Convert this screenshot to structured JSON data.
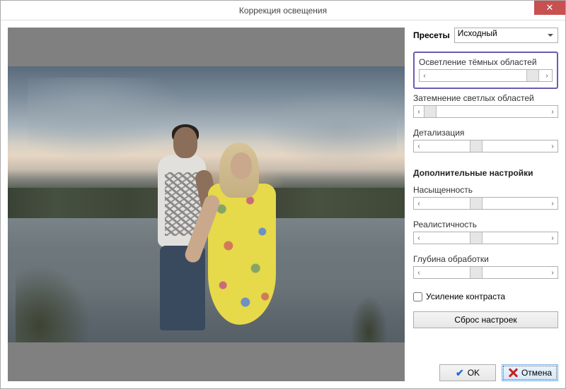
{
  "window": {
    "title": "Коррекция освещения"
  },
  "presets": {
    "label": "Пресеты",
    "selected": "Исходный"
  },
  "sliders": {
    "lighten_dark": {
      "label": "Осветление тёмных областей",
      "position": 92
    },
    "darken_light": {
      "label": "Затемнение светлых областей",
      "position": 0
    },
    "detail": {
      "label": "Детализация",
      "position": 42
    }
  },
  "advanced": {
    "title": "Дополнительные настройки",
    "saturation": {
      "label": "Насыщенность",
      "position": 42
    },
    "realism": {
      "label": "Реалистичность",
      "position": 42
    },
    "depth": {
      "label": "Глубина обработки",
      "position": 42
    }
  },
  "contrast": {
    "label": "Усиление контраста",
    "checked": false
  },
  "buttons": {
    "reset": "Сброс настроек",
    "ok": "OK",
    "cancel": "Отмена"
  }
}
